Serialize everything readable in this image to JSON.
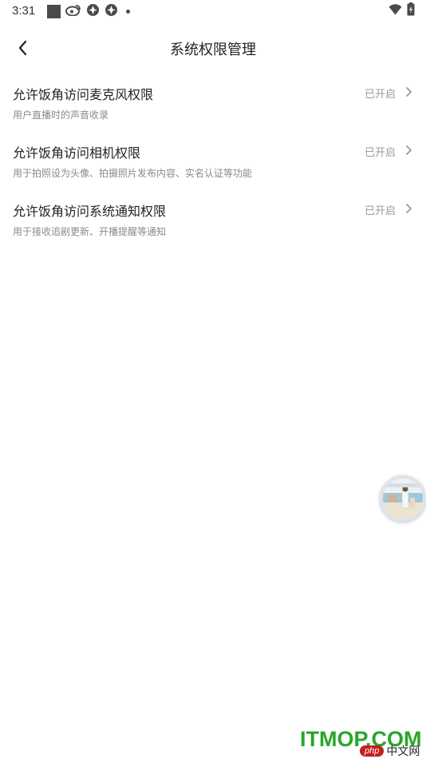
{
  "status_bar": {
    "time": "3:31",
    "left_icons": [
      "notification-square-icon",
      "weibo-icon",
      "app-icon",
      "app-icon",
      "more-dot-icon"
    ],
    "right_icons": [
      "wifi-icon",
      "battery-charging-icon"
    ]
  },
  "header": {
    "title": "系统权限管理",
    "back_icon": "chevron-left-icon"
  },
  "permissions": [
    {
      "title": "允许饭角访问麦克风权限",
      "description": "用户直播时的声音收录",
      "status": "已开启"
    },
    {
      "title": "允许饭角访问相机权限",
      "description": "用于拍照设为头像、拍摄照片发布内容、实名认证等功能",
      "status": "已开启"
    },
    {
      "title": "允许饭角访问系统通知权限",
      "description": "用于接收追剧更新、开播提醒等通知",
      "status": "已开启"
    }
  ],
  "watermark": {
    "text": "ITMOP.COM",
    "badge": "php",
    "site": "中文网"
  },
  "colors": {
    "title_text": "#222222",
    "description_text": "#8a8a8a",
    "status_text": "#9a9a9a",
    "watermark_green": "#2aa52a",
    "watermark_red": "#c41e1e"
  }
}
